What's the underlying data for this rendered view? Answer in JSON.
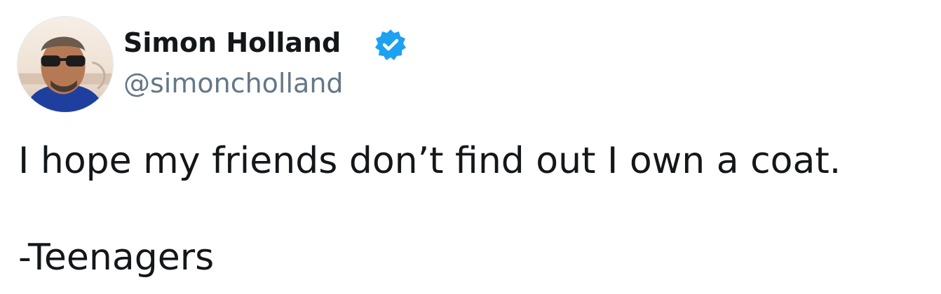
{
  "tweet": {
    "author": {
      "name": "Simon Holland",
      "handle": "@simoncholland",
      "verified_icon": "verified-badge-icon",
      "avatar": "profile-photo"
    },
    "text_lines": [
      "I hope my friends don’t find out I own a coat.",
      "-Teenagers"
    ]
  },
  "colors": {
    "text": "#14171a",
    "handle": "#657786",
    "verified": "#1da1f2",
    "background": "#ffffff"
  }
}
